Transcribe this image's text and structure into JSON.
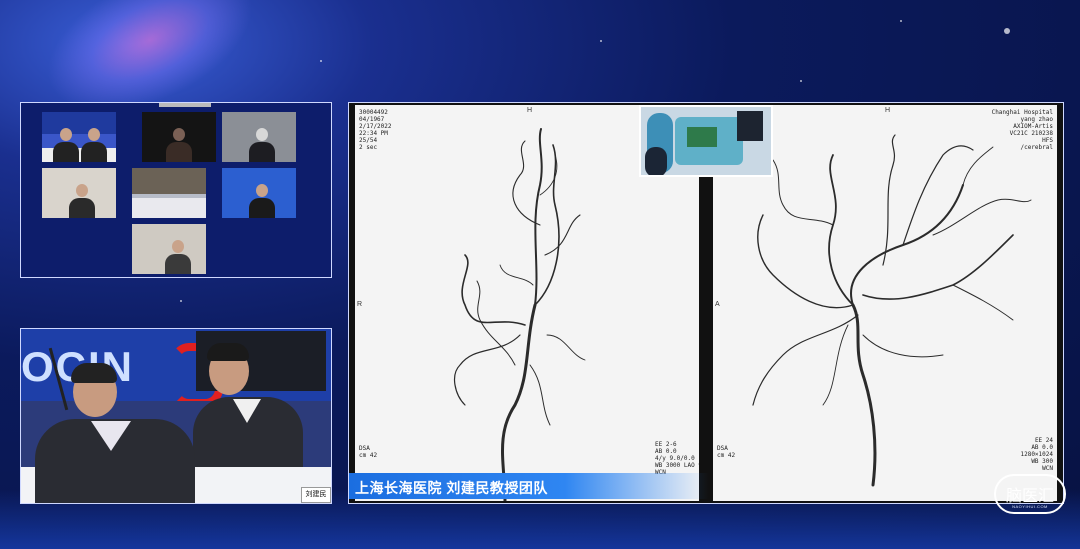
{
  "colors": {
    "background": "#0b1a5c",
    "caption_bar": "#2f86f2",
    "panel_border": "#cfd8ff"
  },
  "meeting_grid": {
    "tiles": [
      {
        "id": "tile-1",
        "caption": ""
      },
      {
        "id": "tile-2",
        "caption": ""
      },
      {
        "id": "tile-3",
        "caption": ""
      },
      {
        "id": "tile-4",
        "caption": ""
      },
      {
        "id": "tile-5",
        "caption": ""
      },
      {
        "id": "tile-6",
        "caption": ""
      },
      {
        "id": "tile-7",
        "caption": ""
      }
    ]
  },
  "speaker_video": {
    "banner_text": "OCIN",
    "nameplate": "刘建民"
  },
  "angiography": {
    "left_frame": {
      "dicom_top_left": "30004492\n04/1967\n2/17/2022\n22:34 PM\n25/54\n2 sec",
      "orient_top": "H",
      "orient_side": "R",
      "dicom_bottom_left": "DSA\ncm 42",
      "dicom_bottom_right": "EE 2-6\nAB 0.0\n4/y 9.0/0.0\nWB 3000 LAO 90°10°\nWCN"
    },
    "right_frame": {
      "dicom_top_right": "Changhai Hospital\nyang zhao\nAXIOM-Artis\nVC21C 210238\nHFS\n/cerebral",
      "orient_top": "H",
      "orient_side": "A",
      "dicom_bottom_left": "DSA\ncm 42",
      "dicom_bottom_right": "EE 24\nAB 0.0\n1280×1024\nWB 300\nWCN"
    },
    "caption": "上海长海医院 刘建民教授团队"
  },
  "logo": {
    "text": "脑医汇",
    "sub": "NAOYIHUI.COM"
  },
  "icons": [
    "logo-badge-icon"
  ]
}
